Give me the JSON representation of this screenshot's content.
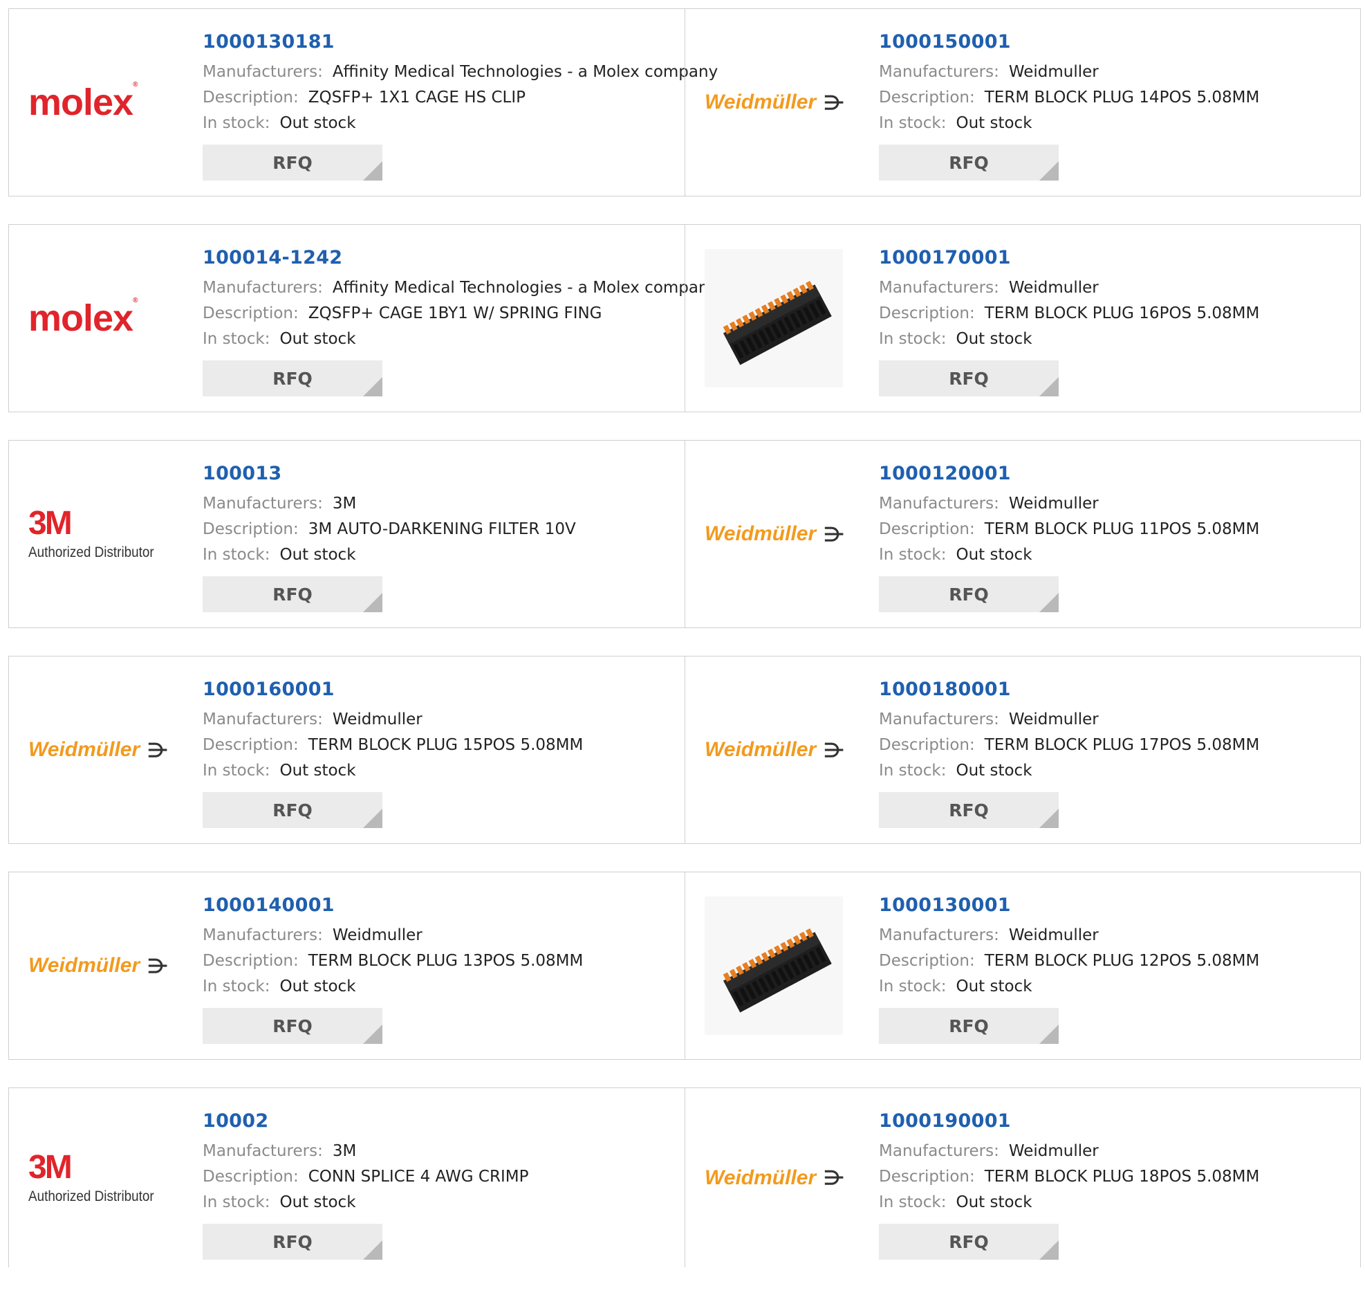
{
  "labels": {
    "manufacturers": "Manufacturers:",
    "description": "Description:",
    "in_stock": "In stock:",
    "rfq": "RFQ"
  },
  "logos": {
    "molex": "molex",
    "weidmuller": "Weidmüller",
    "weidmuller_mark": "⋺",
    "mmm": "3M",
    "mmm_sub": "Authorized Distributor"
  },
  "colors": {
    "part_number": "#1f5fae",
    "molex_red": "#e0242b",
    "weidmuller_orange": "#f29a1e",
    "label_grey": "#8a8a8a",
    "button_bg": "#ebebeb"
  },
  "products": [
    {
      "part": "1000130181",
      "logo": "molex",
      "manufacturer": "Affinity Medical Technologies - a Molex company",
      "description": "ZQSFP+ 1X1 CAGE HS CLIP",
      "stock": "Out stock"
    },
    {
      "part": "1000150001",
      "logo": "weidmuller",
      "manufacturer": "Weidmuller",
      "description": "TERM BLOCK PLUG 14POS 5.08MM",
      "stock": "Out stock"
    },
    {
      "part": "100014-1242",
      "logo": "molex",
      "manufacturer": "Affinity Medical Technologies - a Molex company",
      "description": "ZQSFP+ CAGE 1BY1 W/ SPRING FING",
      "stock": "Out stock"
    },
    {
      "part": "1000170001",
      "logo": "photo",
      "manufacturer": "Weidmuller",
      "description": "TERM BLOCK PLUG 16POS 5.08MM",
      "stock": "Out stock"
    },
    {
      "part": "100013",
      "logo": "mmm",
      "manufacturer": "3M",
      "description": "3M AUTO-DARKENING FILTER 10V",
      "stock": "Out stock"
    },
    {
      "part": "1000120001",
      "logo": "weidmuller",
      "manufacturer": "Weidmuller",
      "description": "TERM BLOCK PLUG 11POS 5.08MM",
      "stock": "Out stock"
    },
    {
      "part": "1000160001",
      "logo": "weidmuller",
      "manufacturer": "Weidmuller",
      "description": "TERM BLOCK PLUG 15POS 5.08MM",
      "stock": "Out stock"
    },
    {
      "part": "1000180001",
      "logo": "weidmuller",
      "manufacturer": "Weidmuller",
      "description": "TERM BLOCK PLUG 17POS 5.08MM",
      "stock": "Out stock"
    },
    {
      "part": "1000140001",
      "logo": "weidmuller",
      "manufacturer": "Weidmuller",
      "description": "TERM BLOCK PLUG 13POS 5.08MM",
      "stock": "Out stock"
    },
    {
      "part": "1000130001",
      "logo": "photo",
      "manufacturer": "Weidmuller",
      "description": "TERM BLOCK PLUG 12POS 5.08MM",
      "stock": "Out stock"
    },
    {
      "part": "10002",
      "logo": "mmm",
      "manufacturer": "3M",
      "description": "CONN SPLICE 4 AWG CRIMP",
      "stock": "Out stock"
    },
    {
      "part": "1000190001",
      "logo": "weidmuller",
      "manufacturer": "Weidmuller",
      "description": "TERM BLOCK PLUG 18POS 5.08MM",
      "stock": "Out stock"
    }
  ]
}
